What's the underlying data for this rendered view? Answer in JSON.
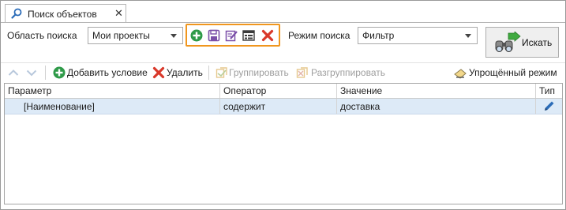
{
  "tab": {
    "label": "Поиск объектов",
    "close_glyph": "✕",
    "icon": "search-icon"
  },
  "search_area": {
    "label": "Область поиска",
    "value": "Мои проекты"
  },
  "query_icons": [
    "add-icon",
    "save-icon",
    "edit-icon",
    "form-view-icon",
    "delete-icon"
  ],
  "search_mode": {
    "label": "Режим поиска",
    "value": "Фильтр"
  },
  "search_button": {
    "label": "Искать",
    "icon": "binoculars-icon"
  },
  "toolbar": {
    "up_icon": "arrow-up-icon",
    "down_icon": "arrow-down-icon",
    "add_condition": "Добавить условие",
    "delete": "Удалить",
    "group": "Группировать",
    "ungroup": "Разгруппировать",
    "simplified_mode": "Упрощённый режим"
  },
  "grid": {
    "columns": [
      "Параметр",
      "Оператор",
      "Значение",
      "Тип"
    ],
    "rows": [
      {
        "parameter": "[Наименование]",
        "operator": "содержит",
        "value": "доставка",
        "type_icon": "pencil-icon"
      }
    ]
  },
  "colors": {
    "accent_orange": "#f0961e",
    "add_green": "#2e9a48",
    "delete_red": "#d9382a",
    "selected_row": "#ddeaf7",
    "tool_purple": "#7b4fa8"
  }
}
